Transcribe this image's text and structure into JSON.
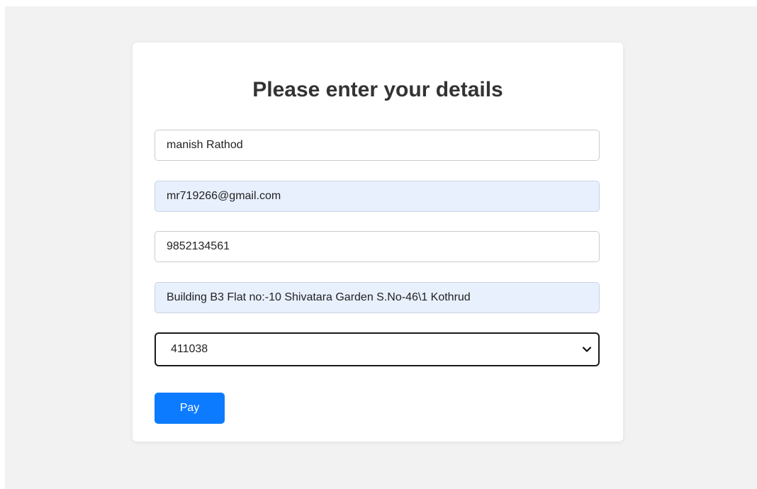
{
  "form": {
    "title": "Please enter your details",
    "fields": {
      "name": "manish Rathod",
      "email": "mr719266@gmail.com",
      "phone": "9852134561",
      "address": "Building B3 Flat no:-10 Shivatara Garden S.No-46\\1 Kothrud"
    },
    "pincode_select": {
      "selected": "411038",
      "icon": "chevron-down-icon"
    },
    "pay_label": "Pay"
  },
  "colors": {
    "page_background": "#f2f2f2",
    "card_background": "#ffffff",
    "autofill_background": "#e8f0fe",
    "button_primary": "#0d7bff"
  }
}
